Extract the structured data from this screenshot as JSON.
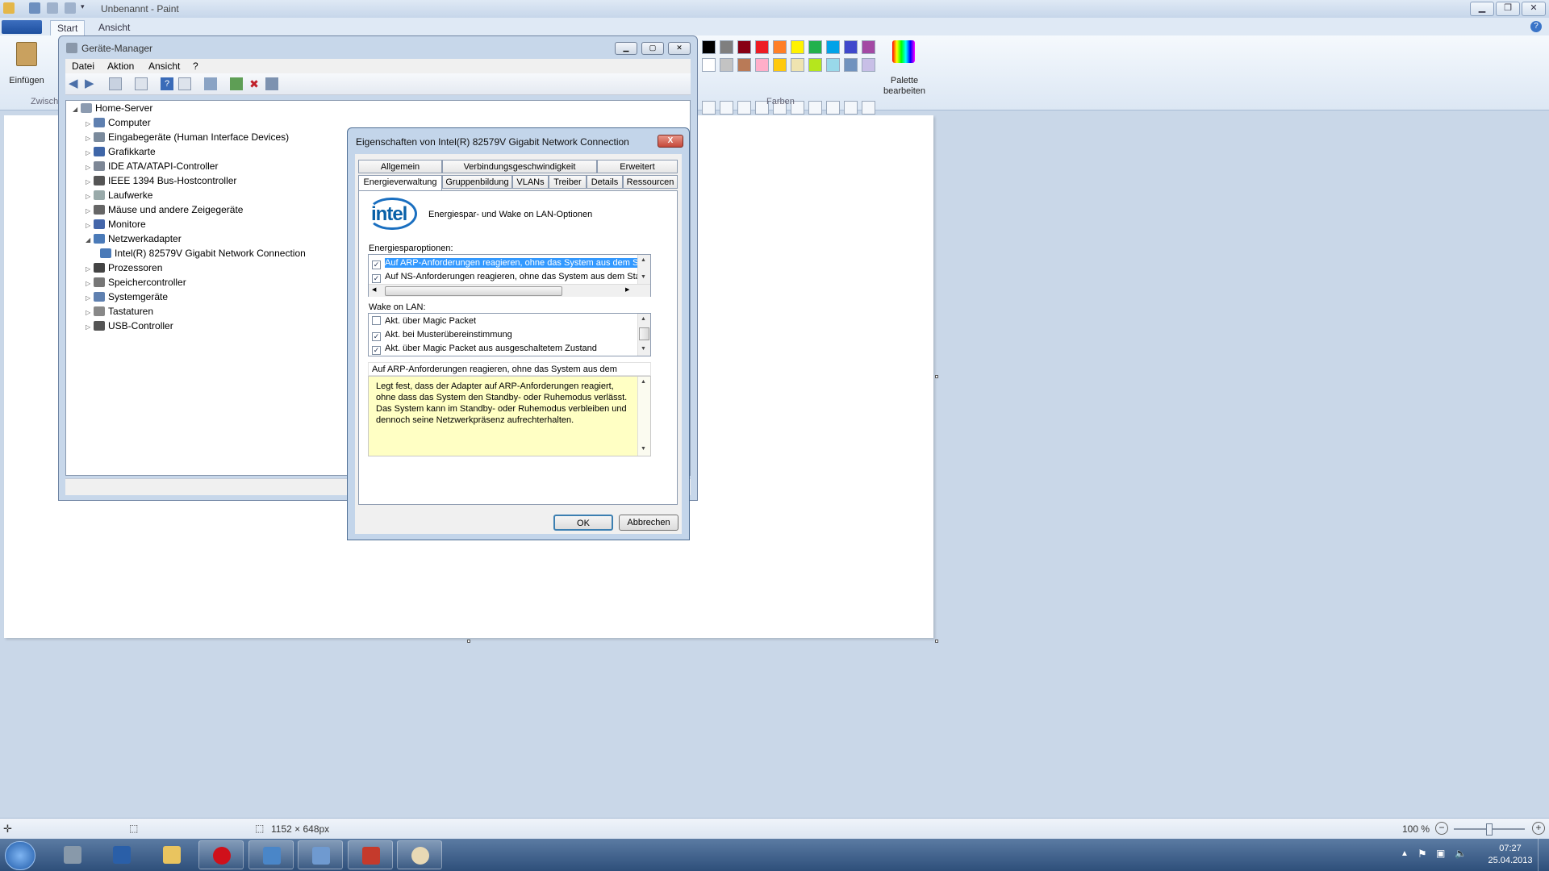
{
  "paint": {
    "title": "Unbenannt - Paint",
    "tabs": [
      "Start",
      "Ansicht"
    ],
    "ribbon": {
      "paste_label": "Einfügen",
      "clipboard_group": "Zwisch",
      "colors_group": "Farben",
      "edit_palette_line1": "Palette",
      "edit_palette_line2": "bearbeiten"
    },
    "palette_row1": [
      "#000000",
      "#7f7f7f",
      "#880015",
      "#ed1c24",
      "#ff7f27",
      "#fff200",
      "#22b14c",
      "#00a2e8",
      "#3f48cc",
      "#a349a4"
    ],
    "palette_row2": [
      "#ffffff",
      "#c3c3c3",
      "#b97a57",
      "#ffaec9",
      "#ffc90e",
      "#efe4b0",
      "#b5e61d",
      "#99d9ea",
      "#7092be",
      "#c8bfe7"
    ],
    "status": {
      "canvas_size": "1152 × 648px",
      "zoom": "100 %"
    }
  },
  "taskbar": {
    "time": "07:27",
    "date": "25.04.2013"
  },
  "device_manager": {
    "title": "Geräte-Manager",
    "menu": [
      "Datei",
      "Aktion",
      "Ansicht",
      "?"
    ],
    "tree": {
      "root": "Home-Server",
      "items": [
        "Computer",
        "Eingabegeräte (Human Interface Devices)",
        "Grafikkarte",
        "IDE ATA/ATAPI-Controller",
        "IEEE 1394 Bus-Hostcontroller",
        "Laufwerke",
        "Mäuse und andere Zeigegeräte",
        "Monitore",
        "Netzwerkadapter",
        "Intel(R) 82579V Gigabit Network Connection",
        "Prozessoren",
        "Speichercontroller",
        "Systemgeräte",
        "Tastaturen",
        "USB-Controller"
      ]
    }
  },
  "properties_dialog": {
    "title": "Eigenschaften von Intel(R) 82579V Gigabit Network Connection",
    "close_label": "X",
    "tabs_row1": [
      "Allgemein",
      "Verbindungsgeschwindigkeit",
      "Erweitert"
    ],
    "tabs_row2": [
      "Energieverwaltung",
      "Gruppenbildung",
      "VLANs",
      "Treiber",
      "Details",
      "Ressourcen"
    ],
    "logo_text": "intel",
    "header_text": "Energiespar- und Wake on LAN-Optionen",
    "energy_label": "Energiesparoptionen:",
    "energy_options": [
      {
        "label": "Auf ARP-Anforderungen reagieren, ohne das System aus dem S",
        "checked": "✓"
      },
      {
        "label": "Auf NS-Anforderungen reagieren, ohne das System aus dem Sta",
        "checked": "✓"
      }
    ],
    "wol_label": "Wake on LAN:",
    "wol_options": [
      {
        "label": "Akt. über Magic Packet",
        "checked": ""
      },
      {
        "label": "Akt. bei Musterübereinstimmung",
        "checked": "✓"
      },
      {
        "label": "Akt. über Magic Packet aus ausgeschaltetem Zustand",
        "checked": "✓"
      }
    ],
    "description_title": "Auf ARP-Anforderungen reagieren, ohne das System aus dem",
    "description_text": "Legt fest, dass der Adapter auf ARP-Anforderungen reagiert, ohne dass das System den Standby- oder Ruhemodus verlässt. Das System kann im Standby- oder Ruhemodus verbleiben und dennoch seine Netzwerkpräsenz aufrechterhalten.",
    "ok_label": "OK",
    "cancel_label": "Abbrechen"
  }
}
